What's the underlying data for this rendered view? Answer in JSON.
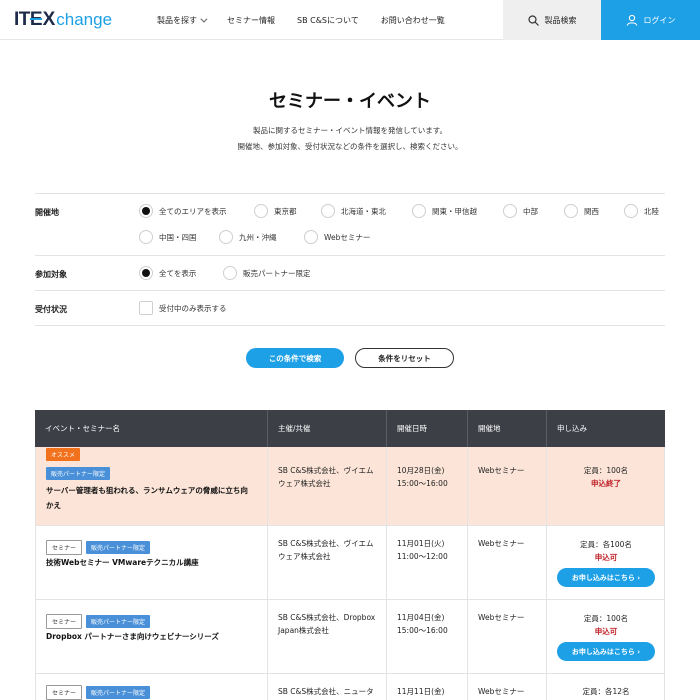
{
  "header": {
    "logo_it": "IT",
    "logo_x": "EX",
    "logo_change": "change",
    "nav": [
      "製品を探す",
      "セミナー情報",
      "SB C&Sについて",
      "お問い合わせ一覧"
    ],
    "product_search": "製品検索",
    "login": "ログイン"
  },
  "page": {
    "title": "セミナー・イベント",
    "desc1": "製品に関するセミナー・イベント情報を発信しています。",
    "desc2": "開催地、参加対象、受付状況などの条件を選択し、検索ください。"
  },
  "filters": {
    "venue_label": "開催地",
    "venue_options": [
      "全てのエリアを表示",
      "東京都",
      "北海道・東北",
      "関東・甲信越",
      "中部",
      "関西",
      "北陸",
      "中国・四国",
      "九州・沖縄",
      "Webセミナー"
    ],
    "venue_selected": "全てのエリアを表示",
    "target_label": "参加対象",
    "target_options": [
      "全てを表示",
      "販売パートナー限定"
    ],
    "target_selected": "全てを表示",
    "status_label": "受付状況",
    "status_checkbox": "受付中のみ表示する",
    "search_button": "この条件で検索",
    "reset_button": "条件をリセット"
  },
  "table": {
    "headers": [
      "イベント・セミナー名",
      "主催/共催",
      "開催日時",
      "開催地",
      "申し込み"
    ],
    "rows": [
      {
        "tags": [
          "オススメ",
          "販売パートナー限定"
        ],
        "name1": "サーバー管理者も狙われる、ランサムウェアの脅威に立ち向",
        "name2": "かえ",
        "host1": "SB C&S株式会社、ヴイエム",
        "host2": "ウェア株式会社",
        "date1": "10月28日(金)",
        "date2": "15:00〜16:00",
        "place": "Webセミナー",
        "capacity": "定員：100名",
        "status": "申込終了",
        "apply": ""
      },
      {
        "tags": [
          "セミナー",
          "販売パートナー限定"
        ],
        "name1": "技術Webセミナー VMwareテクニカル講座",
        "name2": "",
        "host1": "SB C&S株式会社、ヴイエム",
        "host2": "ウェア株式会社",
        "date1": "11月01日(火)",
        "date2": "11:00〜12:00",
        "place": "Webセミナー",
        "capacity": "定員：各100名",
        "status": "申込可",
        "apply": "お申し込みはこちら"
      },
      {
        "tags": [
          "セミナー",
          "販売パートナー限定"
        ],
        "name1": "Dropbox パートナーさま向けウェビナーシリーズ",
        "name2": "",
        "host1": "SB C&S株式会社、Dropbox",
        "host2": "Japan株式会社",
        "date1": "11月04日(金)",
        "date2": "15:00〜16:00",
        "place": "Webセミナー",
        "capacity": "定員：100名",
        "status": "申込可",
        "apply": "お申し込みはこちら"
      },
      {
        "tags": [
          "セミナー",
          "販売パートナー限定"
        ],
        "name1": "",
        "name2": "",
        "host1": "SB C&S株式会社、ニュータ",
        "host2": "",
        "date1": "11月11日(金)",
        "date2": "",
        "place": "Webセミナー",
        "capacity": "定員：各12名",
        "status": "",
        "apply": ""
      }
    ]
  }
}
